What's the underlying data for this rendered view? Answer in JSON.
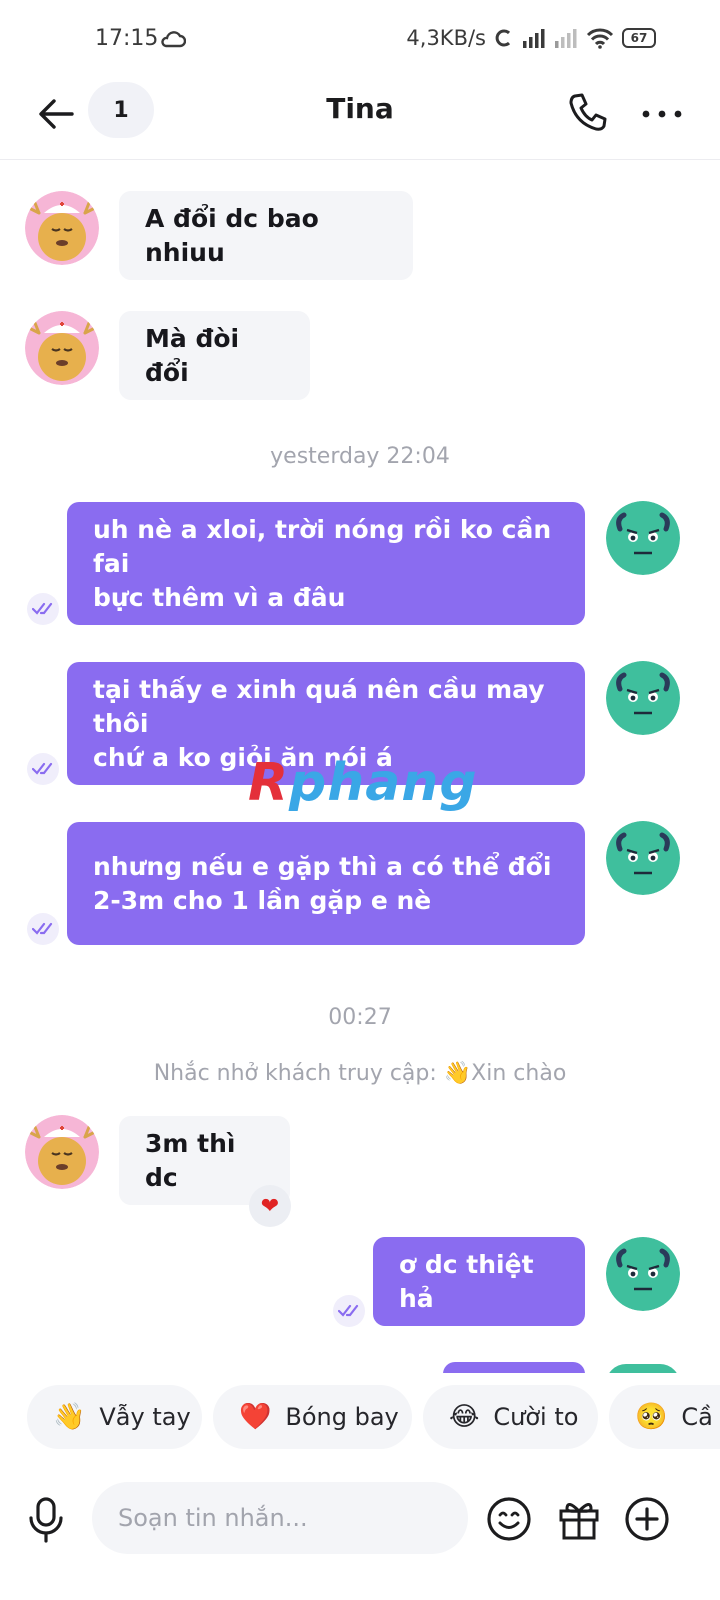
{
  "status_bar": {
    "time": "17:15",
    "net_speed": "4,3KB/s",
    "battery": "67"
  },
  "header": {
    "unread_count": "1",
    "title": "Tina"
  },
  "messages": [
    {
      "side": "in",
      "text": "A đổi dc bao nhiuu"
    },
    {
      "side": "in",
      "text": "Mà đòi đổi"
    },
    {
      "type": "timestamp",
      "text": "yesterday 22:04"
    },
    {
      "side": "out",
      "lines": [
        "uh nè a xloi, trời nóng rồi ko cần fai",
        "bực thêm vì a đâu"
      ]
    },
    {
      "side": "out",
      "lines": [
        "tại thấy e xinh quá nên cầu may thôi",
        "chứ a ko giỏi ăn nói á"
      ]
    },
    {
      "side": "out",
      "lines": [
        "nhưng nếu e gặp thì a có thể đổi",
        "2-3m cho 1 lần gặp e nè"
      ]
    },
    {
      "type": "timestamp",
      "text": "00:27"
    },
    {
      "type": "reminder",
      "text": "Nhắc nhở khách truy cập: 👋Xin chào"
    },
    {
      "side": "in",
      "text": "3m thì dc",
      "reaction": "❤"
    },
    {
      "side": "out",
      "text": "ơ dc thiệt hả"
    }
  ],
  "watermark": {
    "first": "R",
    "rest": "phang"
  },
  "suggestions": [
    {
      "emoji": "👋",
      "label": "Vẫy tay"
    },
    {
      "emoji": "❤️",
      "label": "Bóng bay"
    },
    {
      "emoji": "😂",
      "label": "Cười to"
    },
    {
      "emoji": "🥺",
      "label": "Cầ"
    }
  ],
  "composer": {
    "placeholder": "Soạn tin nhắn..."
  },
  "colors": {
    "outgoing_bubble": "#8a6cf0",
    "incoming_bubble": "#f4f5f8",
    "muted_text": "#a3a5ae"
  },
  "icons": {
    "back": "arrow-left-icon",
    "call": "phone-icon",
    "more": "more-dots-icon",
    "seen": "double-check-icon",
    "mic": "microphone-icon",
    "emoji": "smiley-icon",
    "gift": "gift-icon",
    "plus": "plus-circle-icon"
  }
}
